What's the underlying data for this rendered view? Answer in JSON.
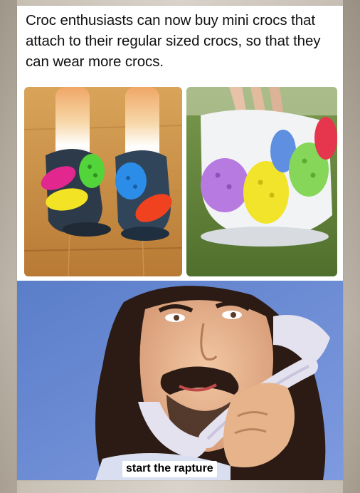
{
  "post": {
    "caption": "Croc enthusiasts can now buy mini crocs that attach to their regular sized crocs, so that they can wear more crocs.",
    "subtitle": "start the rapture"
  },
  "colors": {
    "background": "#d9d3cb",
    "card": "#ffffff",
    "caption_text": "#111111",
    "subtitle_bg": "#ffffff",
    "subtitle_text": "#000000"
  }
}
